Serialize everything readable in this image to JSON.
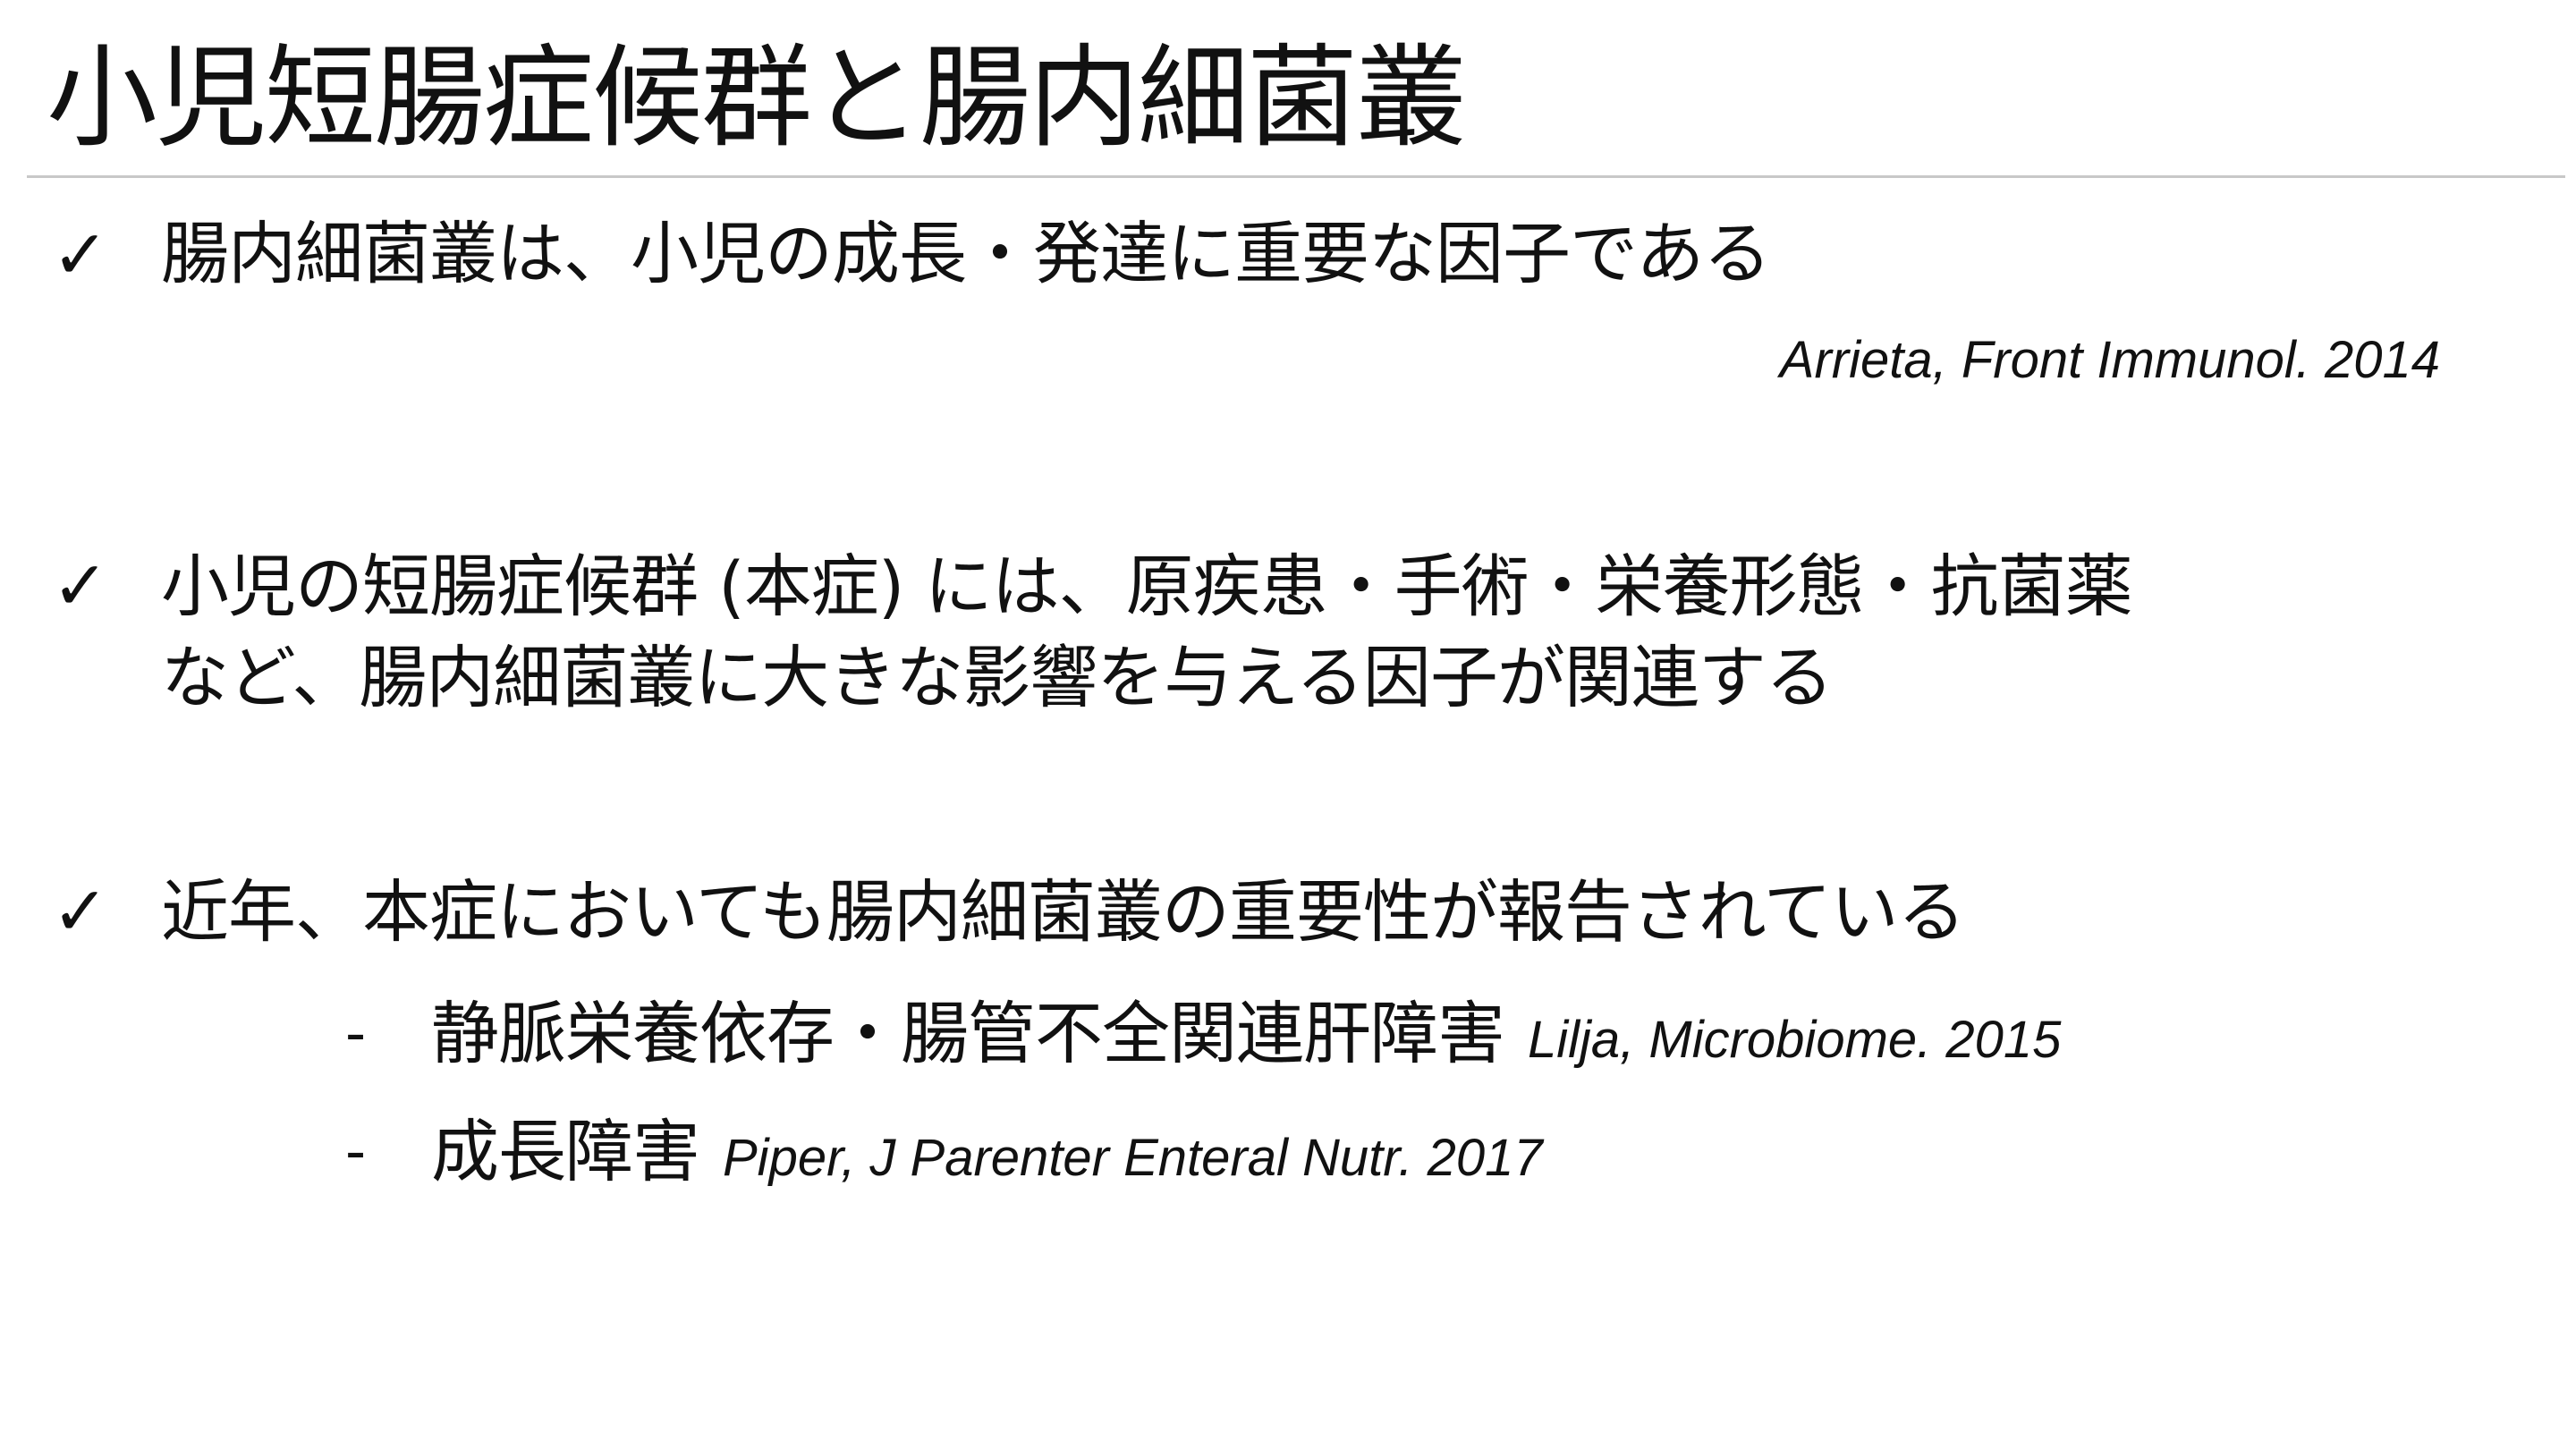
{
  "slide": {
    "title": "小児短腸症候群と腸内細菌叢",
    "check_symbol": "✓",
    "bullets": [
      {
        "lines": [
          "腸内細菌叢は、小児の成長・発達に重要な因子である"
        ],
        "citation": "Arrieta, Front Immunol. 2014"
      },
      {
        "lines": [
          "小児の短腸症候群 (本症) には、原疾患・手術・栄養形態・抗菌薬",
          "など、腸内細菌叢に大きな影響を与える因子が関連する"
        ]
      },
      {
        "lines": [
          "近年、本症においても腸内細菌叢の重要性が報告されている"
        ],
        "subitems": [
          {
            "dash": "-",
            "text": "静脈栄養依存・腸管不全関連肝障害",
            "citation": "Lilja, Microbiome. 2015"
          },
          {
            "dash": "-",
            "text": "成長障害",
            "citation": "Piper, J Parenter Enteral Nutr. 2017"
          }
        ]
      }
    ]
  }
}
